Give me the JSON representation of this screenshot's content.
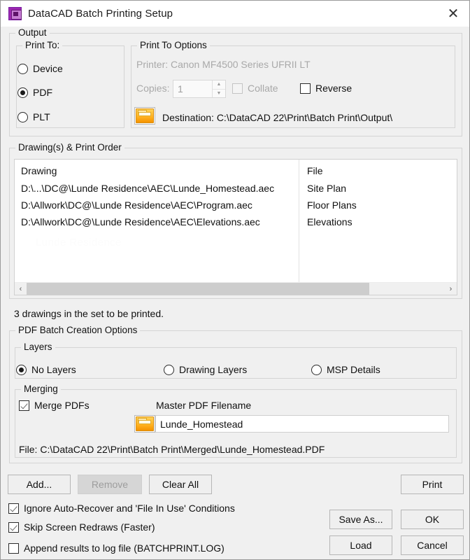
{
  "window": {
    "title": "DataCAD Batch Printing Setup",
    "icon": "datacad-app-icon",
    "close_label": "✕"
  },
  "output": {
    "legend": "Output",
    "print_to": {
      "legend": "Print To:",
      "options": [
        {
          "label": "Device",
          "checked": false
        },
        {
          "label": "PDF",
          "checked": true
        },
        {
          "label": "PLT",
          "checked": false
        }
      ]
    },
    "print_to_options": {
      "legend": "Print To Options",
      "printer_label": "Printer: Canon MF4500 Series UFRII LT",
      "copies_label": "Copies:",
      "copies_value": "1",
      "spinner_up": "▲",
      "spinner_down": "▼",
      "collate": {
        "label": "Collate",
        "checked": false,
        "enabled": false
      },
      "reverse": {
        "label": "Reverse",
        "checked": false,
        "enabled": true
      },
      "destination_label": "Destination: C:\\DataCAD 22\\Print\\Batch Print\\Output\\",
      "destination_icon": "folder-icon"
    }
  },
  "drawings": {
    "legend": "Drawing(s) & Print Order",
    "columns": [
      "Drawing",
      "File"
    ],
    "rows": [
      {
        "drawing": "D:\\...\\DC@\\Lunde Residence\\AEC\\Lunde_Homestead.aec",
        "file": "Site Plan"
      },
      {
        "drawing": "D:\\Allwork\\DC@\\Lunde Residence\\AEC\\Program.aec",
        "file": "Floor Plans"
      },
      {
        "drawing": "D:\\Allwork\\DC@\\Lunde Residence\\AEC\\Elevations.aec",
        "file": "Elevations"
      }
    ],
    "watermark": "Lunde Residence",
    "scroll_left": "‹",
    "scroll_right": "›",
    "status": "3 drawings in the set to be printed."
  },
  "pdf_options": {
    "legend": "PDF Batch Creation Options",
    "layers": {
      "legend": "Layers",
      "options": [
        {
          "label": "No Layers",
          "checked": true
        },
        {
          "label": "Drawing Layers",
          "checked": false
        },
        {
          "label": "MSP Details",
          "checked": false
        }
      ]
    },
    "merging": {
      "legend": "Merging",
      "merge_pdfs": {
        "label": "Merge PDFs",
        "checked": true
      },
      "master_filename_label": "Master PDF Filename",
      "master_filename_value": "Lunde_Homestead",
      "browse_icon": "folder-icon",
      "file_path": "File: C:\\DataCAD 22\\Print\\Batch Print\\Merged\\Lunde_Homestead.PDF"
    }
  },
  "footer": {
    "add_label": "Add...",
    "remove_label": "Remove",
    "remove_enabled": false,
    "clear_all_label": "Clear All",
    "print_label": "Print",
    "save_as_label": "Save As...",
    "ok_label": "OK",
    "load_label": "Load",
    "cancel_label": "Cancel",
    "checkboxes": [
      {
        "label": "Ignore Auto-Recover and 'File In Use' Conditions",
        "checked": true
      },
      {
        "label": "Skip Screen Redraws (Faster)",
        "checked": true
      },
      {
        "label": "Append results to log file (BATCHPRINT.LOG)",
        "checked": false
      }
    ]
  },
  "colors": {
    "dialog_bg": "#f0f0f0",
    "titlebar_bg": "#ffffff",
    "accent_icon": "#9c27b0",
    "folder_icon": "#ffb01f",
    "text": "#101010",
    "disabled_text": "#a9a9a9"
  }
}
